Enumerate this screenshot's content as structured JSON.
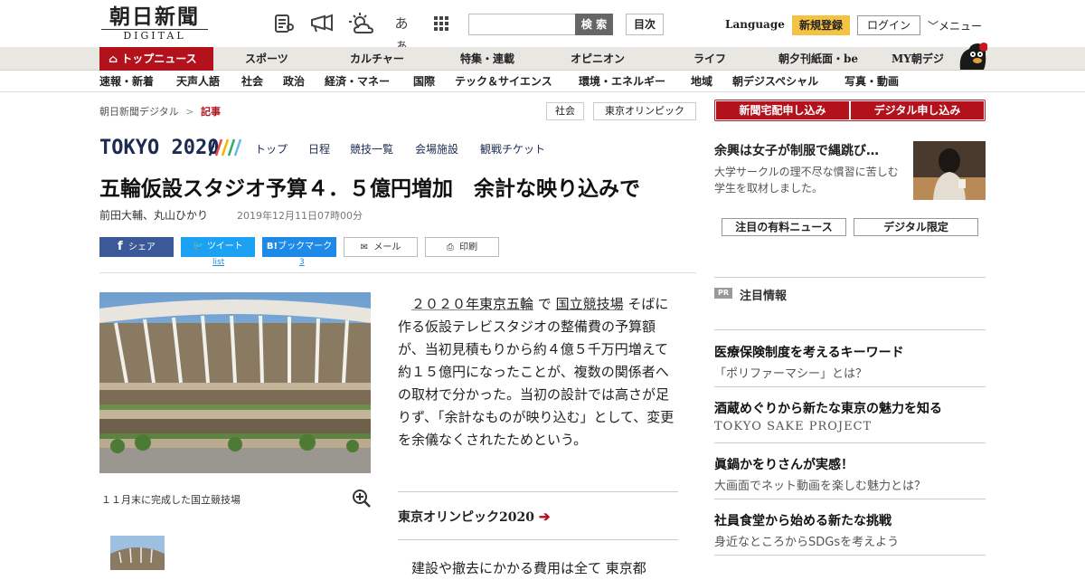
{
  "header": {
    "logo_jp": "朝日新聞",
    "logo_en": "DIGITAL",
    "font_icon_label": "あぁ",
    "search_placeholder": "",
    "search_button": "検 索",
    "toc_button": "目次",
    "language": "Language",
    "register": "新規登録",
    "login": "ログイン",
    "menu": "メニュー"
  },
  "nav_primary": [
    "トップニュース",
    "スポーツ",
    "カルチャー",
    "特集・連載",
    "オピニオン",
    "ライフ",
    "朝夕刊紙面・be",
    "MY朝デジ"
  ],
  "nav_secondary": [
    "速報・新着",
    "天声人語",
    "社会",
    "政治",
    "経済・マネー",
    "国際",
    "テック＆サイエンス",
    "環境・エネルギー",
    "地域",
    "朝デジスペシャル",
    "写真・動画"
  ],
  "breadcrumb": {
    "root": "朝日新聞デジタル",
    "sep": ">",
    "current": "記事"
  },
  "tags": [
    "社会",
    "東京オリンピック"
  ],
  "olympic": {
    "logo": "TOKYO 2020",
    "nav": [
      "トップ",
      "日程",
      "競技一覧",
      "会場施設",
      "観戦チケット"
    ]
  },
  "article": {
    "headline": "五輪仮設スタジオ予算４．５億円増加　余計な映り込みで",
    "authors": "前田大輔、丸山ひかり",
    "date": "2019年12月11日07時00分",
    "share": {
      "facebook": "シェア",
      "twitter": "ツイート",
      "hatena": "ブックマーク",
      "mail": "メール",
      "print": "印刷"
    },
    "twitter_count": "list",
    "hatena_count": "3",
    "photo_caption": "１１月末に完成した国立競技場",
    "body_link1": "２０２０年東京五輪",
    "body_mid1": " で ",
    "body_link2": "国立競技場",
    "body_rest": " そばに作る仮設テレビスタジオの整備費の予算額が、当初見積もりから約４億５千万円増えて約１５億円になったことが、複数の関係者への取材で分かった。当初の設計では高さが足りず、「余計なものが映り込む」として、変更を余儀なくされたためという。",
    "related_link": "東京オリンピック2020",
    "body2": "建設や撤去にかかる費用は全て 東京都"
  },
  "sidebar": {
    "subscribe_paper": "新聞宅配申し込み",
    "subscribe_digital": "デジタル申し込み",
    "feature_title": "余興は女子が制服で縄跳び…",
    "feature_desc": "大学サークルの理不尽な慣習に苦しむ学生を取材しました。",
    "tab_paid": "注目の有料ニュース",
    "tab_digital": "デジタル限定",
    "pr_label": "PR",
    "attention": "注目情報",
    "items": [
      {
        "title": "医療保険制度を考えるキーワード",
        "desc": "「ポリファーマシー」とは？"
      },
      {
        "title": "酒蔵めぐりから新たな東京の魅力を知る",
        "desc": "TOKYO SAKE PROJECT"
      },
      {
        "title": "眞鍋かをりさんが実感！",
        "desc": "大画面でネット動画を楽しむ魅力とは？"
      },
      {
        "title": "社員食堂から始める新たな挑戦",
        "desc": "身近なところからSDGsを考えよう"
      }
    ]
  },
  "colors": {
    "brand_red": "#b3121d",
    "olympic_navy": "#1c2b52",
    "facebook": "#3b5998",
    "twitter": "#1da1f2",
    "hatena": "#1d8ae8",
    "register_yellow": "#f5c342"
  }
}
